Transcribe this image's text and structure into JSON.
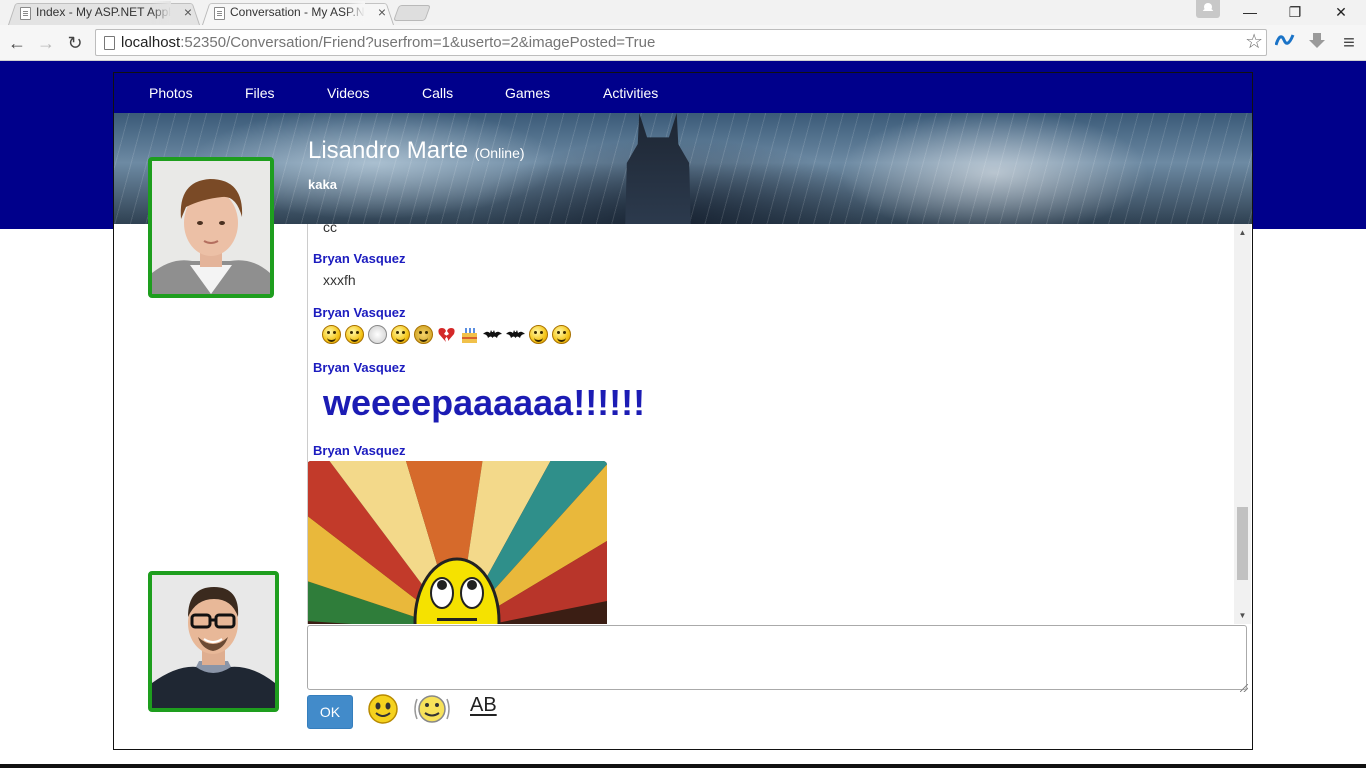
{
  "browser": {
    "tabs": [
      {
        "title": "Index - My ASP.NET Appli",
        "active": false
      },
      {
        "title": "Conversation - My ASP.NE",
        "active": true
      }
    ],
    "tab_close_glyph": "×",
    "url_host": "localhost",
    "url_rest": ":52350/Conversation/Friend?userfrom=1&userto=2&imagePosted=True",
    "back_glyph": "←",
    "forward_glyph": "→",
    "reload_glyph": "↻",
    "star_glyph": "☆",
    "menu_glyph": "≡",
    "minimize_glyph": "—",
    "restore_glyph": "❐",
    "close_glyph": "✕",
    "icons": [
      "back-icon",
      "forward-icon",
      "reload-icon",
      "page-icon",
      "bookmark-star-icon",
      "extension-icon",
      "download-icon",
      "menu-icon"
    ]
  },
  "nav": {
    "items": [
      "Photos",
      "Files",
      "Videos",
      "Calls",
      "Games",
      "Activities"
    ]
  },
  "profile": {
    "name": "Lisandro Marte",
    "status": "(Online)",
    "tagline": "kaka"
  },
  "messages": [
    {
      "author": "",
      "text": "cc"
    },
    {
      "author": "Bryan Vasquez",
      "text": "xxxfh"
    },
    {
      "author": "Bryan Vasquez",
      "type": "emoji",
      "emoji": [
        "nerd-smiley",
        "grin-smiley",
        "plate",
        "smirk-smiley",
        "gears",
        "broken-heart",
        "cake",
        "bat",
        "bat",
        "wink-smiley",
        "wink-smiley"
      ]
    },
    {
      "author": "Bryan Vasquez",
      "text": "weeeepaaaaaa!!!!!!"
    },
    {
      "author": "Bryan Vasquez",
      "type": "image"
    }
  ],
  "composer": {
    "value": "",
    "ok_label": "OK",
    "format_label": "AB",
    "icons": [
      "smiley-icon",
      "animated-smiley-icon",
      "text-format-icon"
    ]
  },
  "colors": {
    "brand_navy": "#00008b",
    "author_blue": "#1c1cbf",
    "avatar_border": "#1e9e1e",
    "ok_button": "#428bca"
  }
}
